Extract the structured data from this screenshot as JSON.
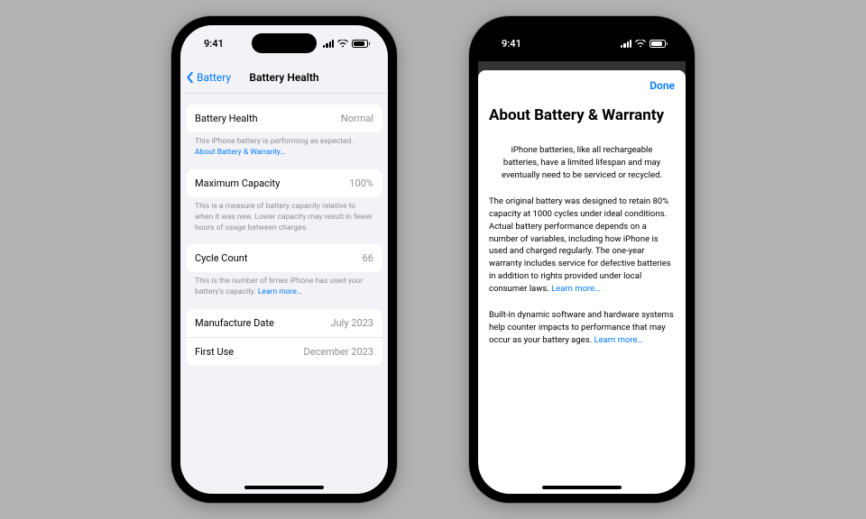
{
  "statusbar": {
    "time": "9:41"
  },
  "left": {
    "nav": {
      "back_label": "Battery",
      "title": "Battery Health"
    },
    "battery_health": {
      "label": "Battery Health",
      "value": "Normal"
    },
    "battery_health_footer": "This iPhone battery is performing as expected.",
    "battery_health_footer_link": "About Battery & Warranty…",
    "max_capacity": {
      "label": "Maximum Capacity",
      "value": "100%"
    },
    "max_capacity_footer": "This is a measure of battery capacity relative to when it was new. Lower capacity may result in fewer hours of usage between charges.",
    "cycle_count": {
      "label": "Cycle Count",
      "value": "66"
    },
    "cycle_count_footer": "This is the number of times iPhone has used your battery's capacity.",
    "cycle_count_footer_link": "Learn more…",
    "manufacture": {
      "label": "Manufacture Date",
      "value": "July 2023"
    },
    "first_use": {
      "label": "First Use",
      "value": "December 2023"
    }
  },
  "right": {
    "done": "Done",
    "title": "About Battery & Warranty",
    "intro": "iPhone batteries, like all rechargeable batteries, have a limited lifespan and may eventually need to be serviced or recycled.",
    "para1": "The original battery was designed to retain 80% capacity at 1000 cycles under ideal conditions. Actual battery performance depends on a number of variables, including how iPhone is used and charged regularly. The one-year warranty includes service for defective batteries in addition to rights provided under local consumer laws.",
    "para1_link": "Learn more…",
    "para2": "Built-in dynamic software and hardware systems help counter impacts to performance that may occur as your battery ages.",
    "para2_link": "Learn more…"
  }
}
